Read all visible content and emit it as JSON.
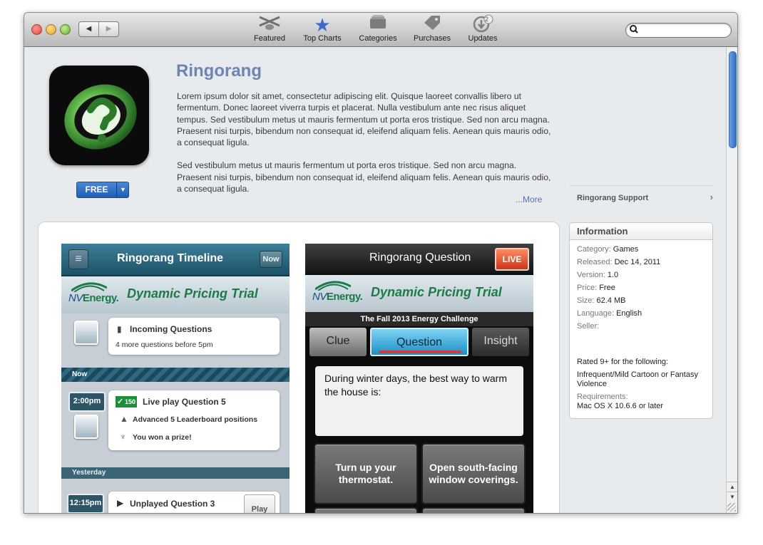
{
  "toolbar": {
    "back_glyph": "◀",
    "forward_glyph": "▶",
    "featured_label": "Featured",
    "top_charts_label": "Top Charts",
    "categories_label": "Categories",
    "purchases_label": "Purchases",
    "updates_label": "Updates",
    "updates_badge": "2",
    "search_placeholder": "",
    "icons": [
      "featured-icon",
      "star-icon",
      "categories-icon",
      "tag-icon",
      "download-icon",
      "search-icon"
    ]
  },
  "app": {
    "name": "Ringorang",
    "price_button": "FREE",
    "description_1": "Lorem ipsum dolor sit amet, consectetur adipiscing elit. Quisque laoreet convallis libero ut fermentum. Donec laoreet viverra turpis et placerat. Nulla vestibulum ante nec risus aliquet tempus. Sed vestibulum metus ut mauris fermentum ut porta eros tristique. Sed non arcu magna. Praesent nisi turpis, bibendum non consequat id, eleifend aliquam felis. Aenean quis mauris odio, a consequat ligula.",
    "description_2": "Sed vestibulum metus ut mauris fermentum ut porta eros tristique. Sed non arcu magna. Praesent nisi turpis, bibendum non consequat id, eleifend aliquam felis. Aenean quis mauris odio, a consequat ligula.",
    "more_link": "...More",
    "support_link": "Ringorang Support",
    "support_chevron": "›"
  },
  "information": {
    "header": "Information",
    "category_key": "Category:",
    "category_val": "Games",
    "released_key": "Released:",
    "released_val": "Dec 14, 2011",
    "version_key": "Version:",
    "version_val": "1.0",
    "price_key": "Price:",
    "price_val": "Free",
    "size_key": "Size:",
    "size_val": "62.4 MB",
    "language_key": "Language:",
    "language_val": "English",
    "seller_key": "Seller:",
    "rated": "Rated 9+ for the following:",
    "rating_reason": "Infrequent/Mild Cartoon or Fantasy Violence",
    "requirements_key": "Requirements:",
    "requirements_val": "Mac OS X 10.6.6 or later"
  },
  "screenshot_1": {
    "title": "Ringorang Timeline",
    "now_button": "Now",
    "logo_nv": "NV",
    "logo_energy": "Energy.",
    "banner_text": "Dynamic Pricing Trial",
    "incoming_title": "Incoming Questions",
    "incoming_sub": "4 more questions before 5pm",
    "now_label": "Now",
    "time_1": "2:00pm",
    "points_badge": "150",
    "live_title": "Live play Question 5",
    "advanced": "Advanced 5 Leaderboard positions",
    "won": "You won a prize!",
    "yesterday_label": "Yesterday",
    "time_2": "12:15pm",
    "unplayed_title": "Unplayed Question 3",
    "play_button": "Play"
  },
  "screenshot_2": {
    "title": "Ringorang Question",
    "live_badge": "LIVE",
    "logo_nv": "NV",
    "logo_energy": "Energy.",
    "banner_text": "Dynamic Pricing Trial",
    "challenge": "The Fall 2013 Energy Challenge",
    "tab_clue": "Clue",
    "tab_question": "Question",
    "tab_insight": "Insight",
    "question_text": "During winter days, the best way to warm the house is:",
    "answer_1": "Turn up your thermostat.",
    "answer_2": "Open south-facing window coverings."
  },
  "colors": {
    "accent_blue": "#2f6fc4",
    "app_title": "#6c86b1",
    "nv_green": "#1f7b45",
    "live_red": "#c7361c"
  }
}
